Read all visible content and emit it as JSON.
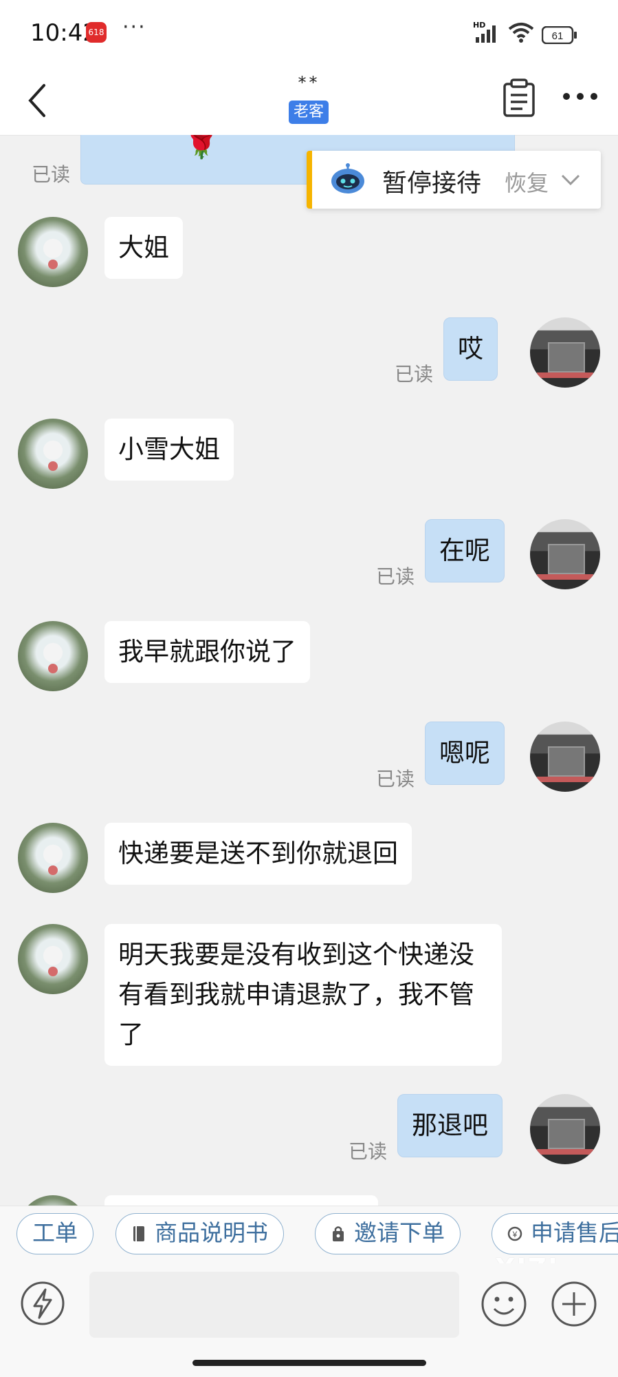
{
  "status_bar": {
    "time": "10:42",
    "badge": "618",
    "network": "HD",
    "battery": "61"
  },
  "header": {
    "title": "**",
    "tag": "老客"
  },
  "pause_card": {
    "label": "暂停接待",
    "action": "恢复"
  },
  "messages": [
    {
      "side": "out",
      "text": "🌹",
      "read": "已读",
      "partial": true
    },
    {
      "side": "in",
      "text": "大姐"
    },
    {
      "side": "out",
      "text": "哎",
      "read": "已读"
    },
    {
      "side": "in",
      "text": "小雪大姐"
    },
    {
      "side": "out",
      "text": "在呢",
      "read": "已读"
    },
    {
      "side": "in",
      "text": "我早就跟你说了"
    },
    {
      "side": "out",
      "text": "嗯呢",
      "read": "已读"
    },
    {
      "side": "in",
      "text": "快递要是送不到你就退回"
    },
    {
      "side": "in",
      "text": "明天我要是没有收到这个快递没有看到我就申请退款了，我不管了"
    },
    {
      "side": "out",
      "text": "那退吧",
      "read": "已读"
    }
  ],
  "quick_actions": [
    {
      "label": "工单",
      "icon": "none"
    },
    {
      "label": "商品说明书",
      "icon": "book-icon"
    },
    {
      "label": "邀请下单",
      "icon": "bag-icon"
    },
    {
      "label": "申请售后",
      "icon": "refund-icon"
    }
  ],
  "watermark": "XIZI",
  "colors": {
    "out_bubble": "#c6dff6",
    "in_bubble": "#ffffff",
    "tag": "#3d7ee8",
    "pause_accent": "#f6b400",
    "chip_text": "#3e6f9e"
  }
}
